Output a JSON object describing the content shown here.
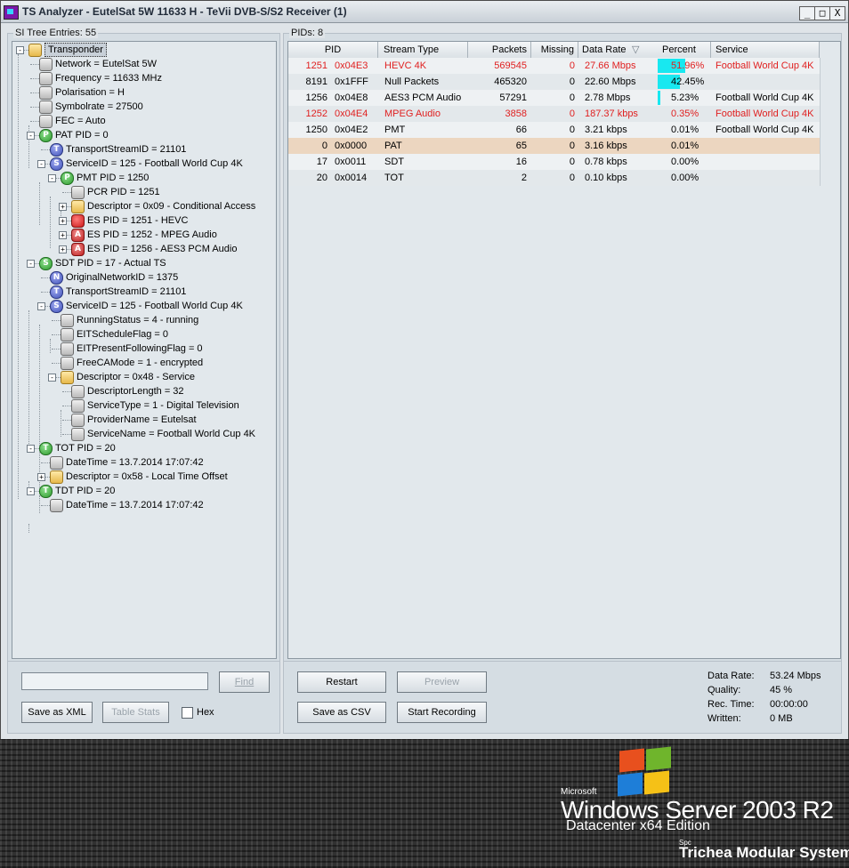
{
  "window": {
    "title": "TS Analyzer - EutelSat 5W 11633 H - TeVii DVB-S/S2 Receiver (1)",
    "minimize": "_",
    "maximize": "□",
    "close": "X"
  },
  "si_tree": {
    "label": "SI Tree Entries: 55",
    "nodes": [
      {
        "text": "Transponder",
        "icon": "folder-icon",
        "letter": ""
      },
      {
        "text": "Network = EutelSat 5W",
        "icon": "item-icon",
        "letter": ""
      },
      {
        "text": "Frequency = 11633 MHz",
        "icon": "item-icon",
        "letter": ""
      },
      {
        "text": "Polarisation = H",
        "icon": "item-icon",
        "letter": ""
      },
      {
        "text": "Symbolrate = 27500",
        "icon": "item-icon",
        "letter": ""
      },
      {
        "text": "FEC = Auto",
        "icon": "item-icon",
        "letter": ""
      },
      {
        "text": "PAT PID = 0",
        "icon": "pat-icon",
        "letter": "P"
      },
      {
        "text": "TransportStreamID = 21101",
        "icon": "table-icon",
        "letter": "T"
      },
      {
        "text": "ServiceID = 125 - Football World Cup 4K",
        "icon": "service-icon",
        "letter": "S"
      },
      {
        "text": "PMT PID = 1250",
        "icon": "pmt-icon",
        "letter": "P"
      },
      {
        "text": "PCR PID = 1251",
        "icon": "item-icon",
        "letter": ""
      },
      {
        "text": "Descriptor = 0x09 - Conditional Access",
        "icon": "folder-icon",
        "letter": ""
      },
      {
        "text": "ES PID = 1251 - HEVC",
        "icon": "video-icon",
        "letter": ""
      },
      {
        "text": "ES PID = 1252 - MPEG Audio",
        "icon": "audio-icon",
        "letter": "A"
      },
      {
        "text": "ES PID = 1256 - AES3 PCM Audio",
        "icon": "audio-icon",
        "letter": "A"
      },
      {
        "text": "SDT PID = 17 - Actual TS",
        "icon": "sdt-icon",
        "letter": "S"
      },
      {
        "text": "OriginalNetworkID = 1375",
        "icon": "network-icon",
        "letter": "N"
      },
      {
        "text": "TransportStreamID = 21101",
        "icon": "table-icon",
        "letter": "T"
      },
      {
        "text": "ServiceID = 125 - Football World Cup 4K",
        "icon": "service-icon",
        "letter": "S"
      },
      {
        "text": "RunningStatus = 4 - running",
        "icon": "item-icon",
        "letter": ""
      },
      {
        "text": "EITScheduleFlag = 0",
        "icon": "item-icon",
        "letter": ""
      },
      {
        "text": "EITPresentFollowingFlag = 0",
        "icon": "item-icon",
        "letter": ""
      },
      {
        "text": "FreeCAMode = 1 - encrypted",
        "icon": "item-icon",
        "letter": ""
      },
      {
        "text": "Descriptor = 0x48 - Service",
        "icon": "folder-icon",
        "letter": ""
      },
      {
        "text": "DescriptorLength = 32",
        "icon": "item-icon",
        "letter": ""
      },
      {
        "text": "ServiceType = 1 - Digital Television",
        "icon": "item-icon",
        "letter": ""
      },
      {
        "text": "ProviderName = Eutelsat",
        "icon": "item-icon",
        "letter": ""
      },
      {
        "text": "ServiceName = Football World Cup 4K",
        "icon": "item-icon",
        "letter": ""
      },
      {
        "text": "TOT PID = 20",
        "icon": "tot-icon",
        "letter": "T"
      },
      {
        "text": "DateTime = 13.7.2014 17:07:42",
        "icon": "item-icon",
        "letter": ""
      },
      {
        "text": "Descriptor = 0x58 - Local Time Offset",
        "icon": "folder-icon",
        "letter": ""
      },
      {
        "text": "TDT PID = 20",
        "icon": "tdt-icon",
        "letter": "T"
      },
      {
        "text": "DateTime = 13.7.2014 17:07:42",
        "icon": "item-icon",
        "letter": ""
      }
    ],
    "find_button": "Find",
    "find_value": "",
    "save_xml_button": "Save as XML",
    "table_stats_button": "Table Stats",
    "hex_label": "Hex"
  },
  "pids": {
    "label": "PIDs: 8",
    "columns": [
      "PID",
      "Stream Type",
      "Packets",
      "Missing",
      "Data Rate",
      "Percent",
      "Service"
    ],
    "sort_arrow": "▽",
    "rows": [
      {
        "pid": "1251",
        "hex": "0x04E3",
        "type": "HEVC 4K",
        "packets": "569545",
        "missing": "0",
        "rate": "27.66 Mbps",
        "percent": "51.96%",
        "pct": 51.96,
        "service": "Football World Cup 4K",
        "highlight": "red"
      },
      {
        "pid": "8191",
        "hex": "0x1FFF",
        "type": "Null Packets",
        "packets": "465320",
        "missing": "0",
        "rate": "22.60 Mbps",
        "percent": "42.45%",
        "pct": 42.45,
        "service": "",
        "highlight": "none"
      },
      {
        "pid": "1256",
        "hex": "0x04E8",
        "type": "AES3 PCM Audio",
        "packets": "57291",
        "missing": "0",
        "rate": "2.78 Mbps",
        "percent": "5.23%",
        "pct": 5.23,
        "service": "Football World Cup 4K",
        "highlight": "none"
      },
      {
        "pid": "1252",
        "hex": "0x04E4",
        "type": "MPEG Audio",
        "packets": "3858",
        "missing": "0",
        "rate": "187.37 kbps",
        "percent": "0.35%",
        "pct": 0.35,
        "service": "Football World Cup 4K",
        "highlight": "red"
      },
      {
        "pid": "1250",
        "hex": "0x04E2",
        "type": "PMT",
        "packets": "66",
        "missing": "0",
        "rate": "3.21 kbps",
        "percent": "0.01%",
        "pct": 0.01,
        "service": "Football World Cup 4K",
        "highlight": "none"
      },
      {
        "pid": "0",
        "hex": "0x0000",
        "type": "PAT",
        "packets": "65",
        "missing": "0",
        "rate": "3.16 kbps",
        "percent": "0.01%",
        "pct": 0.01,
        "service": "",
        "highlight": "selected"
      },
      {
        "pid": "17",
        "hex": "0x0011",
        "type": "SDT",
        "packets": "16",
        "missing": "0",
        "rate": "0.78 kbps",
        "percent": "0.00%",
        "pct": 0.0,
        "service": "",
        "highlight": "none"
      },
      {
        "pid": "20",
        "hex": "0x0014",
        "type": "TOT",
        "packets": "2",
        "missing": "0",
        "rate": "0.10 kbps",
        "percent": "0.00%",
        "pct": 0.0,
        "service": "",
        "highlight": "none"
      }
    ],
    "restart_button": "Restart",
    "preview_button": "Preview",
    "save_csv_button": "Save as CSV",
    "start_recording_button": "Start Recording",
    "stats": {
      "data_rate_label": "Data Rate:",
      "data_rate": "53.24 Mbps",
      "quality_label": "Quality:",
      "quality": "45 %",
      "rec_time_label": "Rec. Time:",
      "rec_time": "00:00:00",
      "written_label": "Written:",
      "written": "0 MB"
    }
  },
  "desktop": {
    "ms": "Microsoft",
    "product": "Windows Server 2003 R2",
    "edition": "Datacenter x64 Edition",
    "spc": "Spc",
    "system": "Trichea Modular System"
  },
  "colors": {
    "red_text": "#e02020",
    "bar": "#18e8f0",
    "selected_row": "#ecd6c0"
  }
}
